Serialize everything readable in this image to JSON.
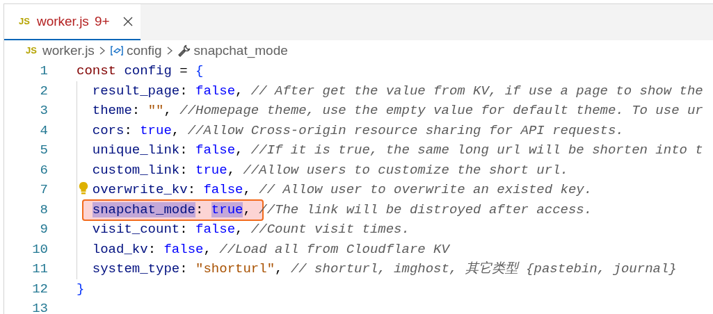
{
  "tabs": [
    {
      "icon_label": "JS",
      "name": "worker.js",
      "problems": "9+",
      "selected": true
    }
  ],
  "breadcrumb": [
    {
      "kind": "file",
      "icon_label": "JS",
      "text": "worker.js"
    },
    {
      "kind": "variable",
      "text": "config"
    },
    {
      "kind": "property",
      "text": "snapchat_mode"
    }
  ],
  "lines": [
    {
      "number": "1",
      "indented": false,
      "lightbulb": false,
      "annotated": false,
      "tokens": [
        {
          "kind": "keyword",
          "text": "const "
        },
        {
          "kind": "variable",
          "text": "config"
        },
        {
          "kind": "operator",
          "text": " = "
        },
        {
          "kind": "brace",
          "text": "{"
        }
      ]
    },
    {
      "number": "2",
      "indented": true,
      "lightbulb": false,
      "annotated": false,
      "tokens": [
        {
          "kind": "property",
          "text": "result_page"
        },
        {
          "kind": "punct",
          "text": ": "
        },
        {
          "kind": "boolean",
          "text": "false"
        },
        {
          "kind": "punct",
          "text": ", "
        },
        {
          "kind": "comment",
          "text": "// After get the value from KV, if use a page to show the"
        }
      ]
    },
    {
      "number": "3",
      "indented": true,
      "lightbulb": false,
      "annotated": false,
      "tokens": [
        {
          "kind": "property",
          "text": "theme"
        },
        {
          "kind": "punct",
          "text": ": "
        },
        {
          "kind": "string",
          "text": "\"\""
        },
        {
          "kind": "punct",
          "text": ", "
        },
        {
          "kind": "comment",
          "text": "//Homepage theme, use the empty value for default theme. To use ur"
        }
      ]
    },
    {
      "number": "4",
      "indented": true,
      "lightbulb": false,
      "annotated": false,
      "tokens": [
        {
          "kind": "property",
          "text": "cors"
        },
        {
          "kind": "punct",
          "text": ": "
        },
        {
          "kind": "boolean",
          "text": "true"
        },
        {
          "kind": "punct",
          "text": ", "
        },
        {
          "kind": "comment",
          "text": "//Allow Cross-origin resource sharing for API requests."
        }
      ]
    },
    {
      "number": "5",
      "indented": true,
      "lightbulb": false,
      "annotated": false,
      "tokens": [
        {
          "kind": "property",
          "text": "unique_link"
        },
        {
          "kind": "punct",
          "text": ": "
        },
        {
          "kind": "boolean",
          "text": "false"
        },
        {
          "kind": "punct",
          "text": ", "
        },
        {
          "kind": "comment",
          "text": "//If it is true, the same long url will be shorten into t"
        }
      ]
    },
    {
      "number": "6",
      "indented": true,
      "lightbulb": false,
      "annotated": false,
      "tokens": [
        {
          "kind": "property",
          "text": "custom_link"
        },
        {
          "kind": "punct",
          "text": ": "
        },
        {
          "kind": "boolean",
          "text": "true"
        },
        {
          "kind": "punct",
          "text": ", "
        },
        {
          "kind": "comment",
          "text": "//Allow users to customize the short url."
        }
      ]
    },
    {
      "number": "7",
      "indented": true,
      "lightbulb": true,
      "annotated": false,
      "tokens": [
        {
          "kind": "property",
          "text": "overwrite_kv"
        },
        {
          "kind": "punct",
          "text": ": "
        },
        {
          "kind": "boolean",
          "text": "false"
        },
        {
          "kind": "punct",
          "text": ", "
        },
        {
          "kind": "comment",
          "text": "// Allow user to overwrite an existed key."
        }
      ]
    },
    {
      "number": "8",
      "indented": true,
      "lightbulb": false,
      "annotated": true,
      "tokens": [
        {
          "kind": "property",
          "text": "snapchat_mode",
          "highlighted": true
        },
        {
          "kind": "punct",
          "text": ": ",
          "highlighted": false
        },
        {
          "kind": "boolean",
          "text": "true",
          "highlighted": true
        },
        {
          "kind": "punct",
          "text": ", ",
          "highlighted": false
        },
        {
          "kind": "comment",
          "text": "//The link will be distroyed after access.",
          "highlighted": false
        }
      ]
    },
    {
      "number": "9",
      "indented": true,
      "lightbulb": false,
      "annotated": false,
      "tokens": [
        {
          "kind": "property",
          "text": "visit_count"
        },
        {
          "kind": "punct",
          "text": ": "
        },
        {
          "kind": "boolean",
          "text": "false"
        },
        {
          "kind": "punct",
          "text": ", "
        },
        {
          "kind": "comment",
          "text": "//Count visit times."
        }
      ]
    },
    {
      "number": "10",
      "indented": true,
      "lightbulb": false,
      "annotated": false,
      "tokens": [
        {
          "kind": "property",
          "text": "load_kv"
        },
        {
          "kind": "punct",
          "text": ": "
        },
        {
          "kind": "boolean",
          "text": "false"
        },
        {
          "kind": "punct",
          "text": ", "
        },
        {
          "kind": "comment",
          "text": "//Load all from Cloudflare KV"
        }
      ]
    },
    {
      "number": "11",
      "indented": true,
      "lightbulb": false,
      "annotated": false,
      "tokens": [
        {
          "kind": "property",
          "text": "system_type"
        },
        {
          "kind": "punct",
          "text": ": "
        },
        {
          "kind": "string",
          "text": "\"shorturl\""
        },
        {
          "kind": "punct",
          "text": ", "
        },
        {
          "kind": "comment",
          "text": "// shorturl, imghost, 其它类型 {pastebin, journal}"
        }
      ]
    },
    {
      "number": "12",
      "indented": false,
      "lightbulb": false,
      "annotated": false,
      "tokens": [
        {
          "kind": "brace",
          "text": "}"
        }
      ]
    },
    {
      "number": "13",
      "indented": false,
      "lightbulb": false,
      "annotated": false
    }
  ]
}
